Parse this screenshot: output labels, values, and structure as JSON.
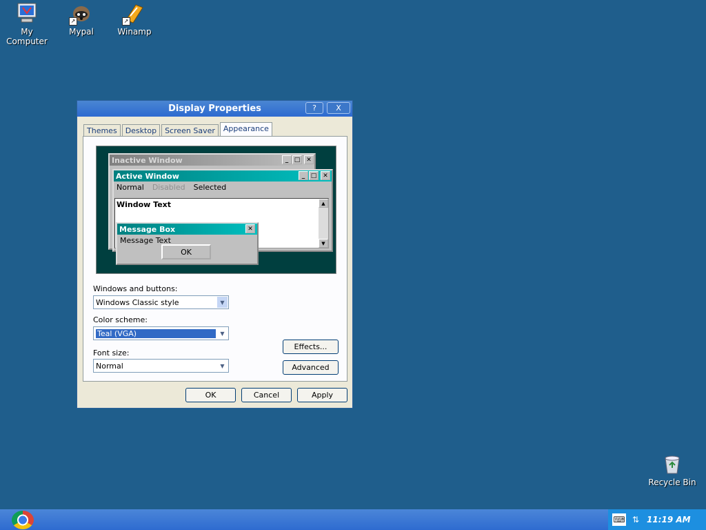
{
  "desktop": {
    "icons": [
      {
        "label": "My Computer",
        "icon": "computer-icon"
      },
      {
        "label": "Mypal",
        "icon": "mypal-icon"
      },
      {
        "label": "Winamp",
        "icon": "winamp-icon"
      },
      {
        "label": "Recycle Bin",
        "icon": "recycle-bin-icon"
      }
    ]
  },
  "dialog": {
    "title": "Display Properties",
    "help_label": "?",
    "close_label": "X",
    "tabs": [
      "Themes",
      "Desktop",
      "Screen Saver",
      "Appearance"
    ],
    "active_tab": "Appearance",
    "preview": {
      "inactive_title": "Inactive Window",
      "active_title": "Active Window",
      "menu": [
        "Normal",
        "Disabled",
        "Selected"
      ],
      "window_text": "Window Text",
      "message_title": "Message Box",
      "message_text": "Message Text",
      "ok_label": "OK"
    },
    "windows_buttons_label": "Windows and buttons:",
    "windows_buttons_value": "Windows Classic style",
    "color_scheme_label": "Color scheme:",
    "color_scheme_value": "Teal (VGA)",
    "font_size_label": "Font size:",
    "font_size_value": "Normal",
    "effects_label": "Effects...",
    "advanced_label": "Advanced",
    "ok_label": "OK",
    "cancel_label": "Cancel",
    "apply_label": "Apply"
  },
  "taskbar": {
    "clock": "11:19 AM",
    "tray_icons": [
      "keyboard-icon",
      "network-icon"
    ]
  },
  "colors": {
    "desktop": "#1f5e8c",
    "preview_bg": "#003f3f",
    "active_title": "#008080"
  }
}
